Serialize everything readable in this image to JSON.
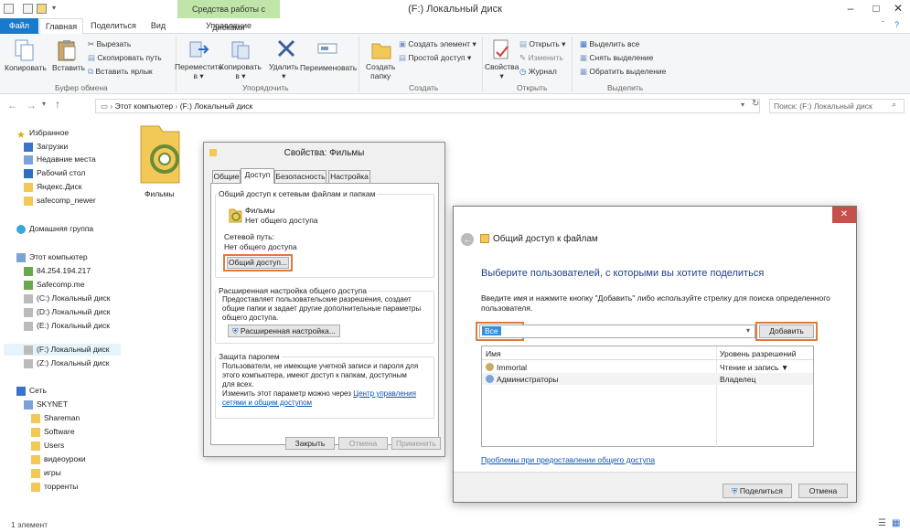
{
  "window": {
    "title": "(F:) Локальный диск",
    "context_tab": "Средства работы с дисками"
  },
  "tabs": [
    "Файл",
    "Главная",
    "Поделиться",
    "Вид",
    "Управление"
  ],
  "ribbon": {
    "clipboard": {
      "copy": "Копировать",
      "paste": "Вставить",
      "cut": "Вырезать",
      "copy_path": "Скопировать путь",
      "paste_shortcut": "Вставить ярлык",
      "label": "Буфер обмена"
    },
    "organize": {
      "move1": "Переместить",
      "move2": "в",
      "copy1": "Копировать",
      "copy2": "в",
      "delete": "Удалить",
      "rename": "Переименовать",
      "label": "Упорядочить"
    },
    "new": {
      "new_folder1": "Создать",
      "new_folder2": "папку",
      "new_item": "Создать элемент",
      "easy_access": "Простой доступ",
      "label": "Создать"
    },
    "open": {
      "properties": "Свойства",
      "open": "Открыть",
      "edit": "Изменить",
      "history": "Журнал",
      "label": "Открыть"
    },
    "select": {
      "select_all": "Выделить все",
      "select_none": "Снять выделение",
      "invert": "Обратить выделение",
      "label": "Выделить"
    }
  },
  "address": {
    "path1": "Этот компьютер",
    "sep": "›",
    "path2": "(F:) Локальный диск",
    "search_placeholder": "Поиск: (F:) Локальный диск"
  },
  "nav": {
    "favorites": "Избранное",
    "fav_items": [
      "Загрузки",
      "Недавние места",
      "Рабочий стол",
      "Яндекс.Диск",
      "safecomp_newer"
    ],
    "homegroup": "Домашняя группа",
    "this_pc": "Этот компьютер",
    "pc_items": [
      "84.254.194.217",
      "Safecomp.me",
      "(C:) Локальный диск",
      "(D:) Локальный диск",
      "(E:) Локальный диск",
      "(F:) Локальный диск",
      "(Z:) Локальный диск"
    ],
    "network": "Сеть",
    "skynet": "SKYNET",
    "net_items": [
      "Shareman",
      "Software",
      "Users",
      "видеоуроки",
      "игры",
      "торренты"
    ]
  },
  "content": {
    "folder_name": "Фильмы"
  },
  "status": "1 элемент",
  "props": {
    "title": "Свойства: Фильмы",
    "tabs": [
      "Общие",
      "Доступ",
      "Безопасность",
      "Настройка"
    ],
    "g1_title": "Общий доступ к сетевым файлам и папкам",
    "folder": "Фильмы",
    "folder_state": "Нет общего доступа",
    "net_path_label": "Сетевой путь:",
    "net_path_value": "Нет общего доступа",
    "share_btn": "Общий доступ...",
    "g2_title": "Расширенная настройка общего доступа",
    "g2_l1": "Предоставляет пользовательские разрешения, создает",
    "g2_l2": "общие папки и задает другие дополнительные параметры",
    "g2_l3": "общего доступа.",
    "adv_btn": "Расширенная настройка...",
    "g3_title": "Защита паролем",
    "g3_l1": "Пользователи, не имеющие учетной записи и пароля для",
    "g3_l2": "этого компьютера, имеют доступ к папкам, доступным",
    "g3_l3": "для всех.",
    "g3_l4": "Изменить этот параметр можно через",
    "g3_link1": "Центр управления",
    "g3_link2": "сетями и общим доступом",
    "close": "Закрыть",
    "cancel": "Отмена",
    "apply": "Применить"
  },
  "share": {
    "title": "Общий доступ к файлам",
    "heading": "Выберите пользователей, с которыми вы хотите поделиться",
    "hint1": "Введите имя и нажмите кнопку \"Добавить\" либо используйте стрелку для поиска определенного",
    "hint2": "пользователя.",
    "input_value": "Все",
    "add_btn": "Добавить",
    "col_name": "Имя",
    "col_perm": "Уровень разрешений",
    "rows": [
      {
        "name": "Immortal",
        "perm": "Чтение и запись"
      },
      {
        "name": "Администраторы",
        "perm": "Владелец"
      }
    ],
    "trouble_link": "Проблемы при предоставлении общего доступа",
    "share_btn": "Поделиться",
    "cancel_btn": "Отмена"
  },
  "colors": {
    "accent": "#1979ca",
    "highlight": "#e07a3b",
    "context_tab": "#bfe6a8",
    "link": "#0a54b3"
  }
}
